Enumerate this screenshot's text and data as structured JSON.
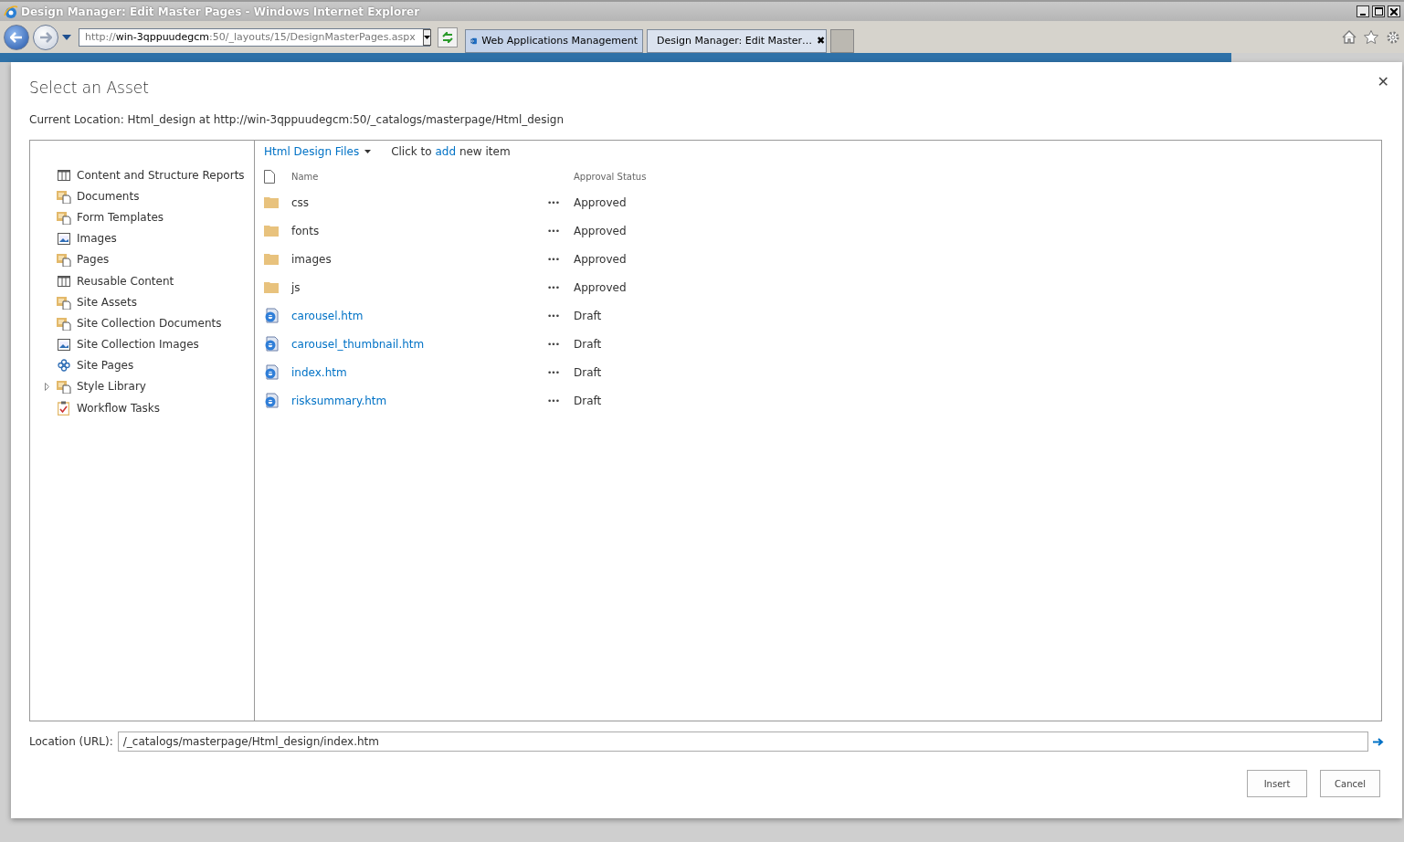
{
  "window": {
    "title": "Design Manager: Edit Master Pages - Windows Internet Explorer"
  },
  "address_bar": {
    "prefix": "http://",
    "host": "win-3qppuudegcm",
    "rest": ":50/_layouts/15/DesignMasterPages.aspx"
  },
  "tabs": [
    {
      "label": "Web Applications Management",
      "selected": false,
      "closable": false
    },
    {
      "label": "Design Manager: Edit Master…",
      "selected": true,
      "closable": true
    }
  ],
  "close_tab_glyph": "✖",
  "dialog": {
    "title": "Select an Asset",
    "close_glyph": "✕",
    "current_location": "Current Location: Html_design at http://win-3qppuudegcm:50/_catalogs/masterpage/Html_design",
    "sidebar": {
      "items": [
        {
          "label": "Content and Structure Reports",
          "kind": "list",
          "expandable": false
        },
        {
          "label": "Documents",
          "kind": "library",
          "expandable": false
        },
        {
          "label": "Form Templates",
          "kind": "library",
          "expandable": false
        },
        {
          "label": "Images",
          "kind": "images",
          "expandable": false
        },
        {
          "label": "Pages",
          "kind": "library",
          "expandable": false
        },
        {
          "label": "Reusable Content",
          "kind": "list",
          "expandable": false
        },
        {
          "label": "Site Assets",
          "kind": "library",
          "expandable": false
        },
        {
          "label": "Site Collection Documents",
          "kind": "library",
          "expandable": false
        },
        {
          "label": "Site Collection Images",
          "kind": "images",
          "expandable": false
        },
        {
          "label": "Site Pages",
          "kind": "wiki",
          "expandable": false
        },
        {
          "label": "Style Library",
          "kind": "library",
          "expandable": true
        },
        {
          "label": "Workflow Tasks",
          "kind": "tasks",
          "expandable": false
        }
      ]
    },
    "view_menu": "Html Design Files",
    "add_hint": {
      "before": "Click to",
      "link": "add",
      "after": "new item"
    },
    "table": {
      "columns": [
        "Name",
        "Approval Status"
      ],
      "menu_glyph": "•••",
      "rows": [
        {
          "name": "css",
          "kind": "folder",
          "status": "Approved"
        },
        {
          "name": "fonts",
          "kind": "folder",
          "status": "Approved"
        },
        {
          "name": "images",
          "kind": "folder",
          "status": "Approved"
        },
        {
          "name": "js",
          "kind": "folder",
          "status": "Approved"
        },
        {
          "name": "carousel.htm",
          "kind": "page",
          "status": "Draft"
        },
        {
          "name": "carousel_thumbnail.htm",
          "kind": "page",
          "status": "Draft"
        },
        {
          "name": "index.htm",
          "kind": "page",
          "status": "Draft"
        },
        {
          "name": "risksummary.htm",
          "kind": "page",
          "status": "Draft"
        }
      ]
    },
    "location_label": "Location (URL):",
    "location_value": "/_catalogs/masterpage/Html_design/index.htm",
    "buttons": [
      "Insert",
      "Cancel"
    ]
  }
}
